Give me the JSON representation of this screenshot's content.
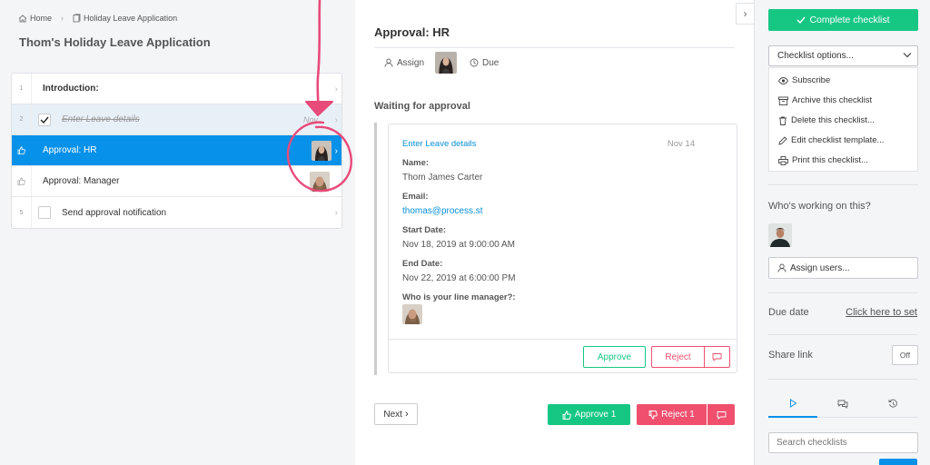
{
  "breadcrumb": {
    "home": "Home",
    "current": "Holiday Leave Application"
  },
  "page_title": "Thom's Holiday Leave Application",
  "tasks": [
    {
      "num": "1",
      "label": "Introduction:",
      "type": "heading"
    },
    {
      "num": "2",
      "label": "Enter Leave details",
      "date": "Nov",
      "type": "done"
    },
    {
      "label": "Approval: HR",
      "type": "approval",
      "active": true
    },
    {
      "label": "Approval: Manager",
      "type": "approval"
    },
    {
      "num": "5",
      "label": "Send approval notification",
      "type": "task"
    }
  ],
  "main": {
    "title": "Approval: HR",
    "assign": "Assign",
    "due": "Due",
    "waiting": "Waiting for approval",
    "card": {
      "link": "Enter Leave details",
      "date": "Nov 14",
      "fields": [
        {
          "label": "Name:",
          "value": "Thom James Carter"
        },
        {
          "label": "Email:",
          "value": "thomas@process.st",
          "link": true
        },
        {
          "label": "Start Date:",
          "value": "Nov 18, 2019 at 9:00:00 AM"
        },
        {
          "label": "End Date:",
          "value": "Nov 22, 2019 at 6:00:00 PM"
        },
        {
          "label": "Who is your line manager?:",
          "value": ""
        }
      ],
      "approve": "Approve",
      "reject": "Reject"
    },
    "next": "Next",
    "approve_all": "Approve 1",
    "reject_all": "Reject 1"
  },
  "sidebar": {
    "complete": "Complete checklist",
    "options": "Checklist options...",
    "menu": [
      "Subscribe",
      "Archive this checklist",
      "Delete this checklist...",
      "Edit checklist template...",
      "Print this checklist..."
    ],
    "working": "Who's working on this?",
    "assign_users": "Assign users...",
    "due_date": "Due date",
    "due_link": "Click here to set",
    "share": "Share link",
    "toggle": "Off",
    "search_placeholder": "Search checklists"
  },
  "colors": {
    "primary": "#0891e8",
    "success": "#16c784",
    "danger": "#f0506e",
    "annotation": "#e84a7a"
  },
  "icons": [
    "home-icon",
    "checklist-icon",
    "thumbs-up-icon",
    "thumbs-down-icon",
    "chevron-right-icon",
    "user-icon",
    "clock-icon",
    "comment-icon",
    "check-icon",
    "eye-icon",
    "archive-icon",
    "trash-icon",
    "edit-icon",
    "print-icon",
    "play-icon",
    "chat-icon",
    "history-icon"
  ]
}
